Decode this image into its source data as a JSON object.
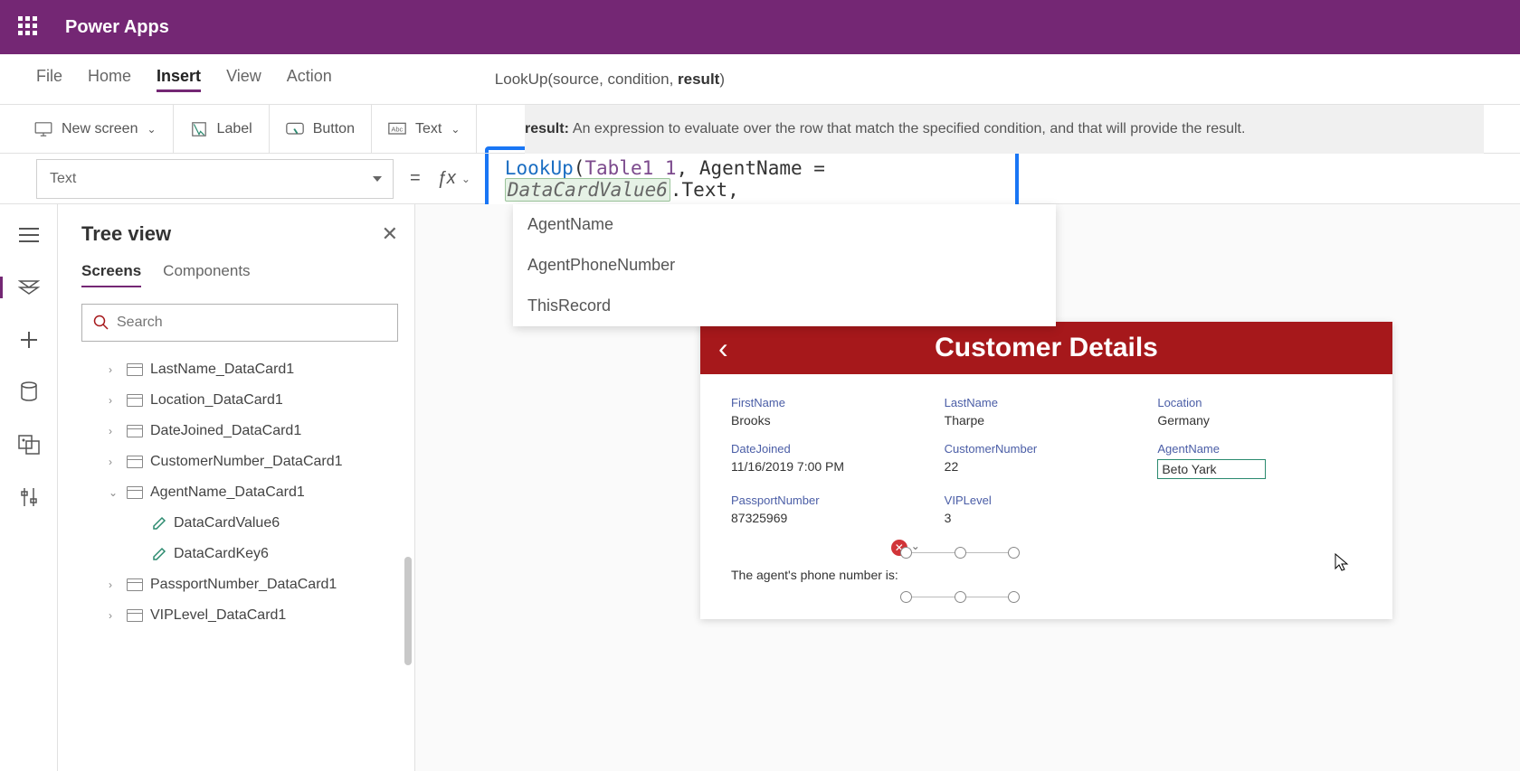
{
  "app": {
    "title": "Power Apps"
  },
  "menu": {
    "file": "File",
    "home": "Home",
    "insert": "Insert",
    "view": "View",
    "action": "Action"
  },
  "func_sig": {
    "prefix": "LookUp(source, condition, ",
    "bold": "result",
    "suffix": ")"
  },
  "toolbar": {
    "newscreen": "New screen",
    "label": "Label",
    "button": "Button",
    "text": "Text"
  },
  "help": {
    "lead": "result:",
    "body": " An expression to evaluate over the row that match the specified condition, and that will provide the result."
  },
  "property": "Text",
  "formula": {
    "fn": "LookUp",
    "table": "Table1_1",
    "arg": "AgentName",
    "eq": " = ",
    "ref": "DataCardValue6",
    "tail": ".Text,"
  },
  "intellisense": [
    "AgentName",
    "AgentPhoneNumber",
    "ThisRecord"
  ],
  "tree": {
    "title": "Tree view",
    "tabs": {
      "screens": "Screens",
      "components": "Components"
    },
    "search_placeholder": "Search",
    "nodes": [
      {
        "label": "LastName_DataCard1",
        "expanded": false,
        "depth": 0,
        "icon": "card"
      },
      {
        "label": "Location_DataCard1",
        "expanded": false,
        "depth": 0,
        "icon": "card"
      },
      {
        "label": "DateJoined_DataCard1",
        "expanded": false,
        "depth": 0,
        "icon": "card"
      },
      {
        "label": "CustomerNumber_DataCard1",
        "expanded": false,
        "depth": 0,
        "icon": "card"
      },
      {
        "label": "AgentName_DataCard1",
        "expanded": true,
        "depth": 0,
        "icon": "card"
      },
      {
        "label": "DataCardValue6",
        "depth": 1,
        "icon": "pencil"
      },
      {
        "label": "DataCardKey6",
        "depth": 1,
        "icon": "pencil"
      },
      {
        "label": "PassportNumber_DataCard1",
        "expanded": false,
        "depth": 0,
        "icon": "card"
      },
      {
        "label": "VIPLevel_DataCard1",
        "expanded": false,
        "depth": 0,
        "icon": "card"
      }
    ]
  },
  "preview": {
    "title": "Customer Details",
    "fields": [
      [
        {
          "label": "FirstName",
          "value": "Brooks"
        },
        {
          "label": "LastName",
          "value": "Tharpe"
        },
        {
          "label": "Location",
          "value": "Germany"
        }
      ],
      [
        {
          "label": "DateJoined",
          "value": "11/16/2019 7:00 PM"
        },
        {
          "label": "CustomerNumber",
          "value": "22"
        },
        {
          "label": "AgentName",
          "value": "Beto Yark",
          "selected": true
        }
      ],
      [
        {
          "label": "PassportNumber",
          "value": "87325969"
        },
        {
          "label": "VIPLevel",
          "value": "3"
        },
        {
          "label": "",
          "value": ""
        }
      ]
    ],
    "agent_phone_label": "The agent's phone number is:"
  }
}
